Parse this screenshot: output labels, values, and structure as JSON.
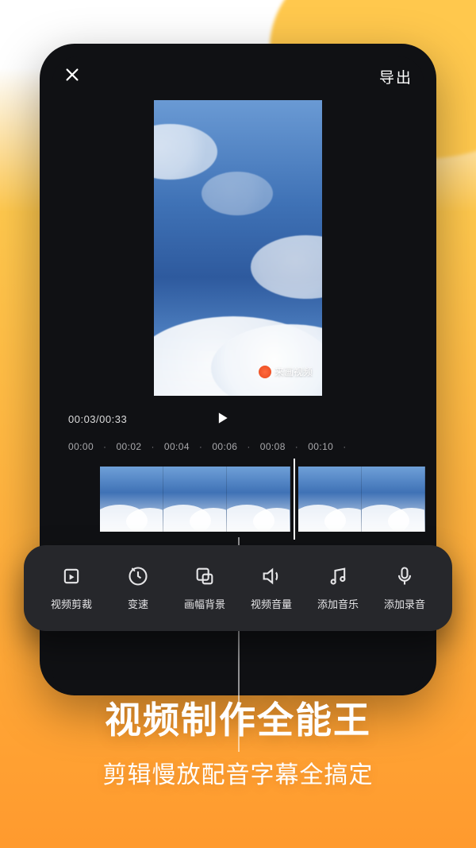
{
  "header": {
    "export_label": "导出"
  },
  "preview": {
    "watermark_text": "来画视频"
  },
  "playback": {
    "time_display": "00:03/00:33"
  },
  "ruler": {
    "ticks": [
      "00:00",
      "00:02",
      "00:04",
      "00:06",
      "00:08",
      "00:10"
    ]
  },
  "tools": [
    {
      "id": "crop",
      "label": "视频剪裁"
    },
    {
      "id": "speed",
      "label": "变速"
    },
    {
      "id": "canvas-bg",
      "label": "画幅背景"
    },
    {
      "id": "volume",
      "label": "视频音量"
    },
    {
      "id": "add-music",
      "label": "添加音乐"
    },
    {
      "id": "add-voice",
      "label": "添加录音"
    }
  ],
  "promo": {
    "title": "视频制作全能王",
    "subtitle": "剪辑慢放配音字幕全搞定"
  }
}
